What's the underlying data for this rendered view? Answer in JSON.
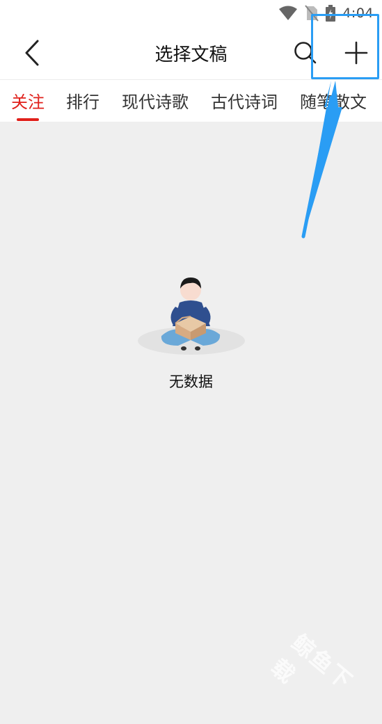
{
  "status_bar": {
    "time": "4:04",
    "icons": [
      "wifi-icon",
      "no-sim-icon",
      "battery-charging-icon"
    ]
  },
  "header": {
    "title": "选择文稿",
    "back_icon": "chevron-left-icon",
    "search_icon": "search-icon",
    "add_icon": "plus-icon"
  },
  "tabs": [
    {
      "label": "关注",
      "active": true
    },
    {
      "label": "排行",
      "active": false
    },
    {
      "label": "现代诗歌",
      "active": false
    },
    {
      "label": "古代诗词",
      "active": false
    },
    {
      "label": "随笔散文",
      "active": false
    }
  ],
  "empty_state": {
    "text": "无数据",
    "illustration": "person-with-empty-box"
  },
  "watermark": {
    "text": "鲸鱼下载"
  },
  "colors": {
    "accent": "#e0201b",
    "annotation": "#2a9df4",
    "background": "#efefef"
  }
}
